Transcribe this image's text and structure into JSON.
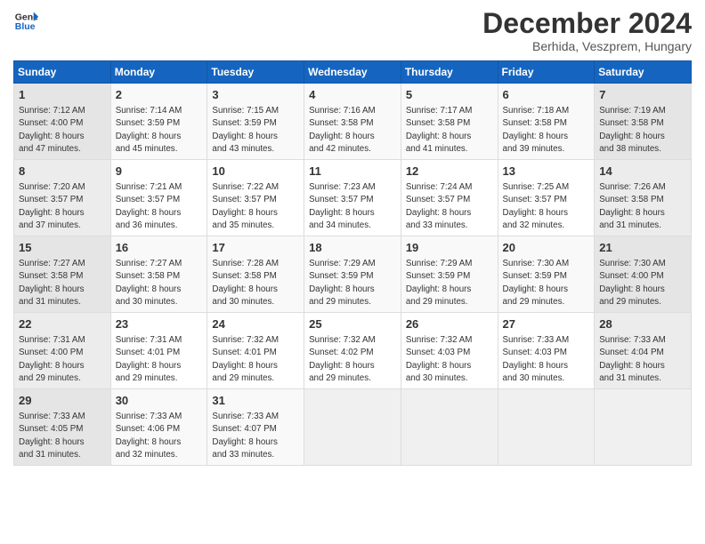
{
  "header": {
    "logo_line1": "General",
    "logo_line2": "Blue",
    "month": "December 2024",
    "location": "Berhida, Veszprem, Hungary"
  },
  "weekdays": [
    "Sunday",
    "Monday",
    "Tuesday",
    "Wednesday",
    "Thursday",
    "Friday",
    "Saturday"
  ],
  "weeks": [
    [
      {
        "day": "1",
        "info": "Sunrise: 7:12 AM\nSunset: 4:00 PM\nDaylight: 8 hours\nand 47 minutes."
      },
      {
        "day": "2",
        "info": "Sunrise: 7:14 AM\nSunset: 3:59 PM\nDaylight: 8 hours\nand 45 minutes."
      },
      {
        "day": "3",
        "info": "Sunrise: 7:15 AM\nSunset: 3:59 PM\nDaylight: 8 hours\nand 43 minutes."
      },
      {
        "day": "4",
        "info": "Sunrise: 7:16 AM\nSunset: 3:58 PM\nDaylight: 8 hours\nand 42 minutes."
      },
      {
        "day": "5",
        "info": "Sunrise: 7:17 AM\nSunset: 3:58 PM\nDaylight: 8 hours\nand 41 minutes."
      },
      {
        "day": "6",
        "info": "Sunrise: 7:18 AM\nSunset: 3:58 PM\nDaylight: 8 hours\nand 39 minutes."
      },
      {
        "day": "7",
        "info": "Sunrise: 7:19 AM\nSunset: 3:58 PM\nDaylight: 8 hours\nand 38 minutes."
      }
    ],
    [
      {
        "day": "8",
        "info": "Sunrise: 7:20 AM\nSunset: 3:57 PM\nDaylight: 8 hours\nand 37 minutes."
      },
      {
        "day": "9",
        "info": "Sunrise: 7:21 AM\nSunset: 3:57 PM\nDaylight: 8 hours\nand 36 minutes."
      },
      {
        "day": "10",
        "info": "Sunrise: 7:22 AM\nSunset: 3:57 PM\nDaylight: 8 hours\nand 35 minutes."
      },
      {
        "day": "11",
        "info": "Sunrise: 7:23 AM\nSunset: 3:57 PM\nDaylight: 8 hours\nand 34 minutes."
      },
      {
        "day": "12",
        "info": "Sunrise: 7:24 AM\nSunset: 3:57 PM\nDaylight: 8 hours\nand 33 minutes."
      },
      {
        "day": "13",
        "info": "Sunrise: 7:25 AM\nSunset: 3:57 PM\nDaylight: 8 hours\nand 32 minutes."
      },
      {
        "day": "14",
        "info": "Sunrise: 7:26 AM\nSunset: 3:58 PM\nDaylight: 8 hours\nand 31 minutes."
      }
    ],
    [
      {
        "day": "15",
        "info": "Sunrise: 7:27 AM\nSunset: 3:58 PM\nDaylight: 8 hours\nand 31 minutes."
      },
      {
        "day": "16",
        "info": "Sunrise: 7:27 AM\nSunset: 3:58 PM\nDaylight: 8 hours\nand 30 minutes."
      },
      {
        "day": "17",
        "info": "Sunrise: 7:28 AM\nSunset: 3:58 PM\nDaylight: 8 hours\nand 30 minutes."
      },
      {
        "day": "18",
        "info": "Sunrise: 7:29 AM\nSunset: 3:59 PM\nDaylight: 8 hours\nand 29 minutes."
      },
      {
        "day": "19",
        "info": "Sunrise: 7:29 AM\nSunset: 3:59 PM\nDaylight: 8 hours\nand 29 minutes."
      },
      {
        "day": "20",
        "info": "Sunrise: 7:30 AM\nSunset: 3:59 PM\nDaylight: 8 hours\nand 29 minutes."
      },
      {
        "day": "21",
        "info": "Sunrise: 7:30 AM\nSunset: 4:00 PM\nDaylight: 8 hours\nand 29 minutes."
      }
    ],
    [
      {
        "day": "22",
        "info": "Sunrise: 7:31 AM\nSunset: 4:00 PM\nDaylight: 8 hours\nand 29 minutes."
      },
      {
        "day": "23",
        "info": "Sunrise: 7:31 AM\nSunset: 4:01 PM\nDaylight: 8 hours\nand 29 minutes."
      },
      {
        "day": "24",
        "info": "Sunrise: 7:32 AM\nSunset: 4:01 PM\nDaylight: 8 hours\nand 29 minutes."
      },
      {
        "day": "25",
        "info": "Sunrise: 7:32 AM\nSunset: 4:02 PM\nDaylight: 8 hours\nand 29 minutes."
      },
      {
        "day": "26",
        "info": "Sunrise: 7:32 AM\nSunset: 4:03 PM\nDaylight: 8 hours\nand 30 minutes."
      },
      {
        "day": "27",
        "info": "Sunrise: 7:33 AM\nSunset: 4:03 PM\nDaylight: 8 hours\nand 30 minutes."
      },
      {
        "day": "28",
        "info": "Sunrise: 7:33 AM\nSunset: 4:04 PM\nDaylight: 8 hours\nand 31 minutes."
      }
    ],
    [
      {
        "day": "29",
        "info": "Sunrise: 7:33 AM\nSunset: 4:05 PM\nDaylight: 8 hours\nand 31 minutes."
      },
      {
        "day": "30",
        "info": "Sunrise: 7:33 AM\nSunset: 4:06 PM\nDaylight: 8 hours\nand 32 minutes."
      },
      {
        "day": "31",
        "info": "Sunrise: 7:33 AM\nSunset: 4:07 PM\nDaylight: 8 hours\nand 33 minutes."
      },
      {
        "day": "",
        "info": ""
      },
      {
        "day": "",
        "info": ""
      },
      {
        "day": "",
        "info": ""
      },
      {
        "day": "",
        "info": ""
      }
    ]
  ]
}
